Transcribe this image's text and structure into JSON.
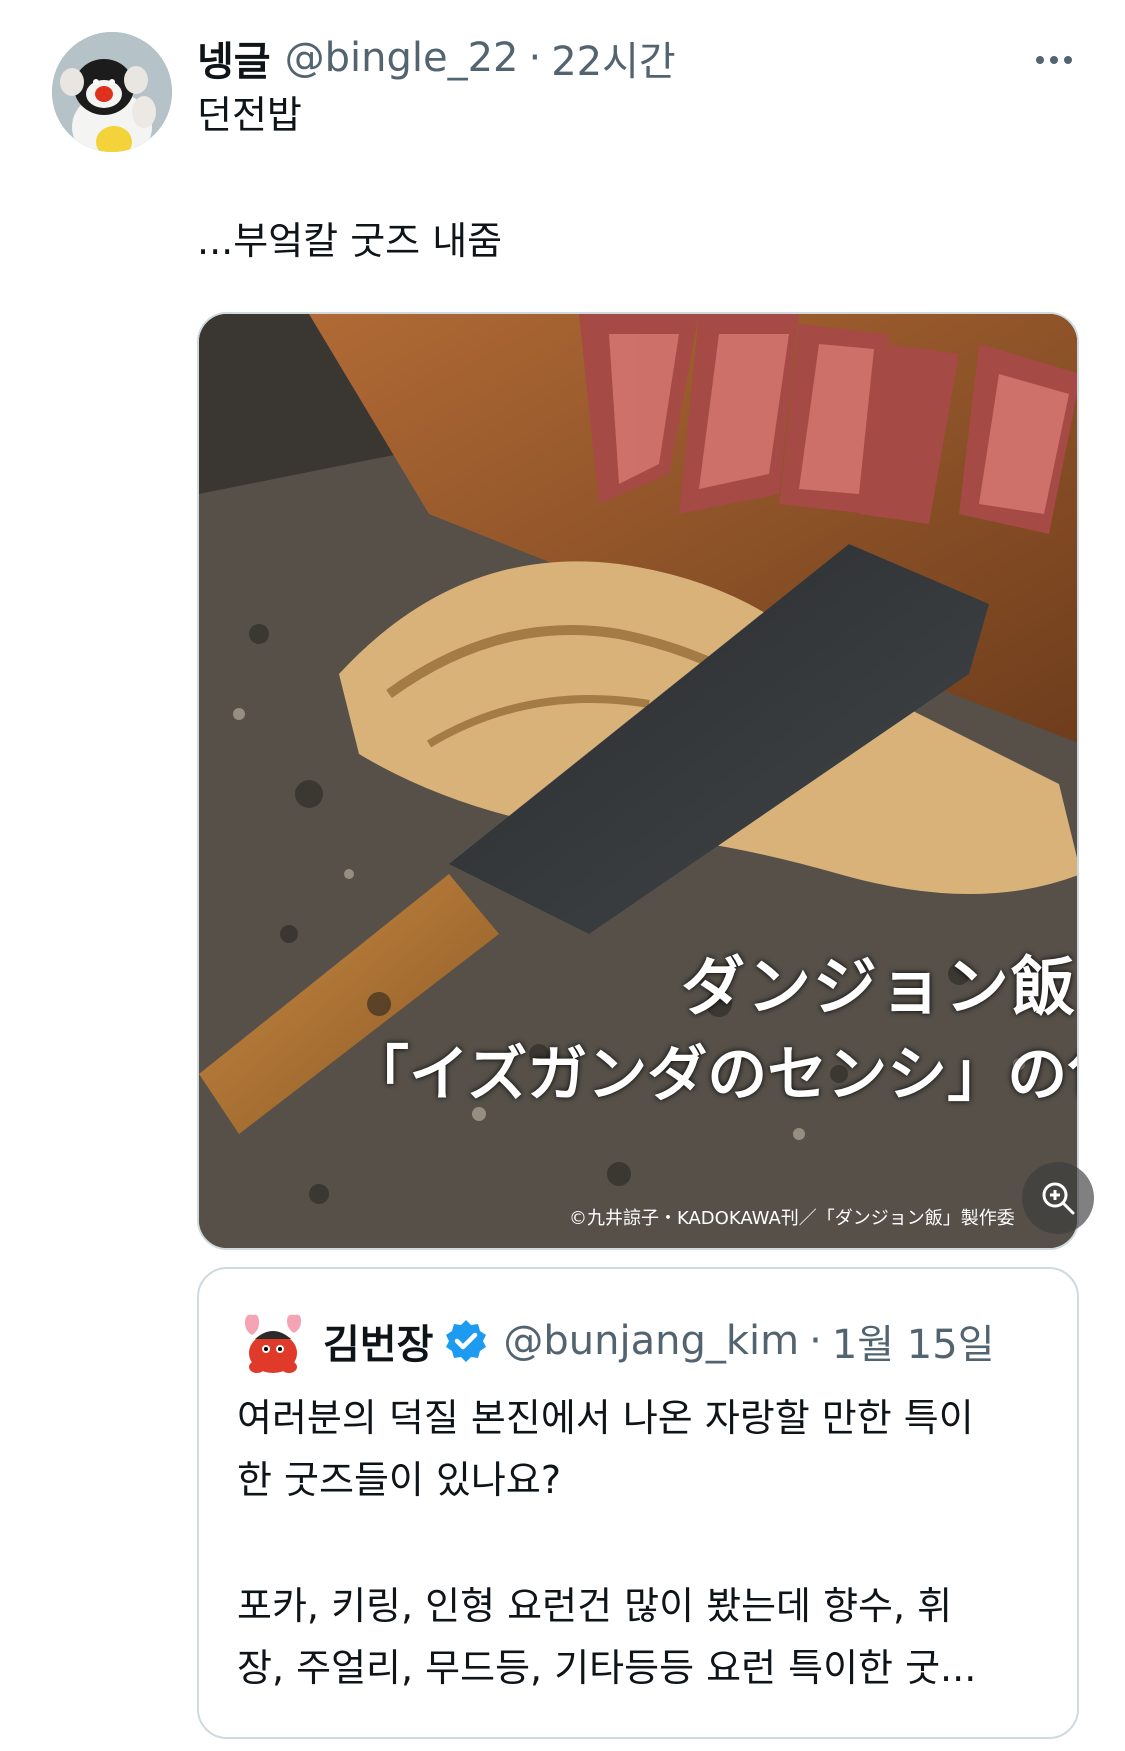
{
  "tweet": {
    "display_name": "넹글",
    "handle": "@bingle_22",
    "separator": "·",
    "time": "22시간",
    "line1": "던전밥",
    "line2": "...부엌칼 굿즈 내줌",
    "avatar_icon": "penguin-avatar-icon",
    "more_icon": "more-icon"
  },
  "media": {
    "overlay_title_line1": "ダンジョン飯",
    "overlay_title_line2": "「イズガンダのセンシ」の包丁",
    "copyright": "©九井諒子・KADOKAWA刊／「ダンジョン飯」製作委",
    "zoom_icon": "zoom-in-icon"
  },
  "quote": {
    "display_name": "김번장",
    "verified_icon": "verified-badge-icon",
    "handle": "@bunjang_kim",
    "separator": "·",
    "time": "1월 15일",
    "lines": [
      "여러분의 덕질 본진에서 나온 자랑할 만한 특이",
      "한 굿즈들이 있나요?",
      "포카, 키링, 인형 요런건 많이 봤는데 향수, 휘",
      "장, 주얼리, 무드등, 기타등등 요런 특이한 굿..."
    ]
  },
  "colors": {
    "text": "#0f1419",
    "secondary": "#536471",
    "border": "#cfd9de",
    "verified": "#1d9bf0"
  }
}
